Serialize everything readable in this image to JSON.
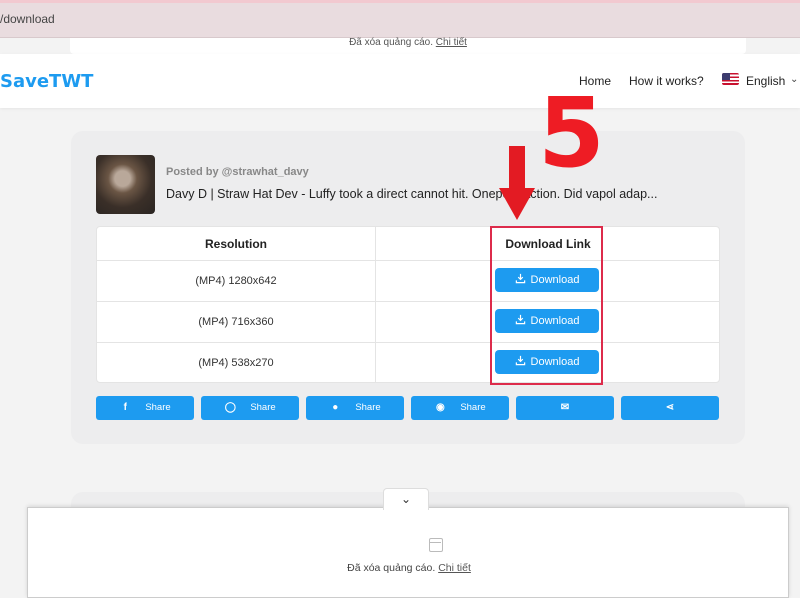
{
  "browser": {
    "url": "/download"
  },
  "ad_top": {
    "text": "Đã xóa quảng cáo.",
    "link": "Chi tiết"
  },
  "header": {
    "logo": "SaveTWT",
    "nav": {
      "home": "Home",
      "how": "How it works?",
      "language": "English"
    }
  },
  "post": {
    "posted_by": "Posted by @strawhat_davy",
    "description": "Davy D | Straw Hat Dev - Luffy took a direct cannot hit. Onepe     e action. Did vapol adap..."
  },
  "table": {
    "headers": {
      "resolution": "Resolution",
      "download": "Download Link"
    },
    "rows": [
      {
        "resolution": "(MP4) 1280x642",
        "button": "Download"
      },
      {
        "resolution": "(MP4) 716x360",
        "button": "Download"
      },
      {
        "resolution": "(MP4) 538x270",
        "button": "Download"
      }
    ]
  },
  "annotation": {
    "step": "5",
    "color": "#ee1c24"
  },
  "share_buttons": [
    {
      "icon": "facebook-icon",
      "glyph": "f",
      "label": "Share"
    },
    {
      "icon": "whatsapp-icon",
      "glyph": "◯",
      "label": "Share"
    },
    {
      "icon": "reddit-icon",
      "glyph": "●",
      "label": "Share"
    },
    {
      "icon": "messenger-icon",
      "glyph": "◉",
      "label": "Share"
    },
    {
      "icon": "email-icon",
      "glyph": "✉",
      "label": ""
    },
    {
      "icon": "share-icon",
      "glyph": "⋖",
      "label": ""
    }
  ],
  "ad_bottom": {
    "text": "Đã xóa quảng cáo.",
    "link": "Chi tiết",
    "chevron": "⌄"
  },
  "colors": {
    "accent": "#1d9bf0",
    "highlight": "#dd2b4b"
  }
}
